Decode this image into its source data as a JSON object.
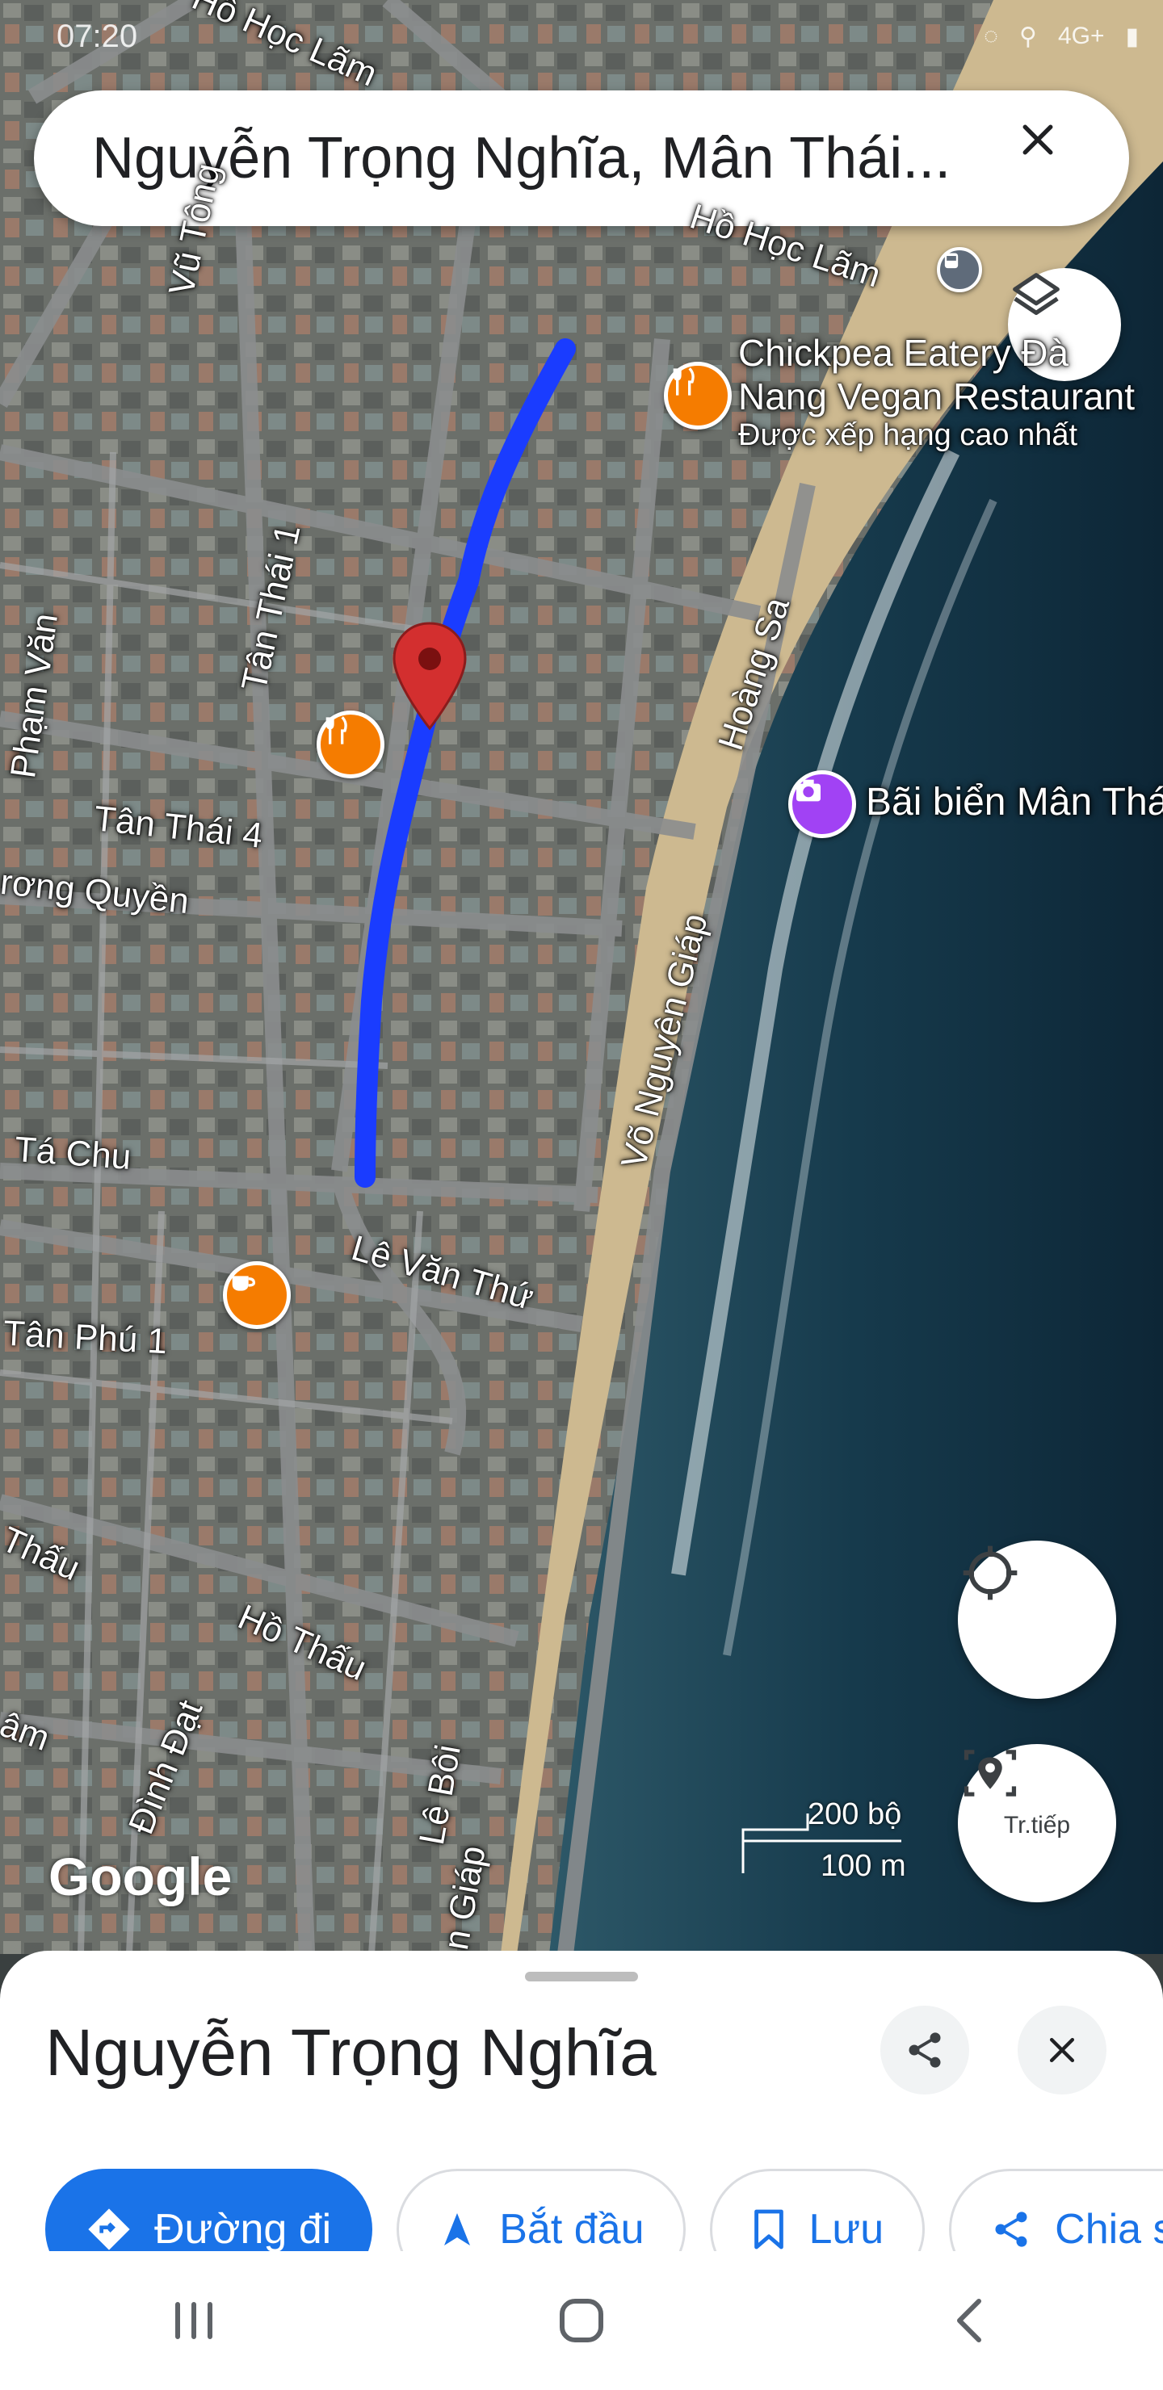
{
  "status_bar": {
    "time": "07:20",
    "signal": "4G+"
  },
  "search": {
    "query": "Nguyễn Trọng Nghĩa, Mân Thái..."
  },
  "map": {
    "streets": [
      {
        "text": "Hồ Học Lãm",
        "ref": "hohoclam1"
      },
      {
        "text": "Hồ Học Lãm",
        "ref": "hohoclam2"
      },
      {
        "text": "Vũ Tông",
        "ref": "vutong"
      },
      {
        "text": "Tân Thái 1",
        "ref": "tanthai1"
      },
      {
        "text": "Phạm Văn",
        "ref": "phamvan"
      },
      {
        "text": "Tân Thái 4",
        "ref": "tanthai4"
      },
      {
        "text": "rơng Quyền",
        "ref": "quyen"
      },
      {
        "text": "Hoàng Sa",
        "ref": "hoangsa"
      },
      {
        "text": "Võ Nguyên Giáp",
        "ref": "vonguyengiap"
      },
      {
        "text": "Tá Chu",
        "ref": "tachu"
      },
      {
        "text": "Lê Văn Thứ",
        "ref": "levanthu"
      },
      {
        "text": "Tân Phú 1",
        "ref": "tanphu1"
      },
      {
        "text": "Thấu",
        "ref": "thau"
      },
      {
        "text": "Hồ Thấu",
        "ref": "hothau"
      },
      {
        "text": "Đình Đạt",
        "ref": "dinhdat"
      },
      {
        "text": "Lê Bôi",
        "ref": "leboi"
      },
      {
        "text": "âm",
        "ref": "am"
      },
      {
        "text": "n Giáp",
        "ref": "ngiap"
      }
    ],
    "places": {
      "restaurant_name_1": "Chickpea Eatery Đà",
      "restaurant_name_2": "Nang Vegan Restaurant",
      "restaurant_note": "Được xếp hạng cao nhất",
      "beach": "Bãi biển Mân Thái"
    },
    "scale": {
      "feet": "200 bộ",
      "meters": "100 m"
    },
    "attribution": "Google",
    "colors": {
      "route": "#1a3cff",
      "pin": "#d32f2f",
      "food_pin": "#f57c00",
      "photo_pin": "#a142f4",
      "transit": "#5f6b7a"
    }
  },
  "controls": {
    "explore_label": "Tr.tiếp",
    "layers_icon": "layers-icon",
    "locate_icon": "my-location-icon"
  },
  "sheet": {
    "title": "Nguyễn Trọng Nghĩa",
    "chips": [
      {
        "label": "Đường đi",
        "icon": "directions-icon"
      },
      {
        "label": "Bắt đầu",
        "icon": "navigation-arrow-icon"
      },
      {
        "label": "Lưu",
        "icon": "bookmark-icon"
      },
      {
        "label": "Chia sẻ",
        "icon": "share-icon"
      }
    ]
  }
}
